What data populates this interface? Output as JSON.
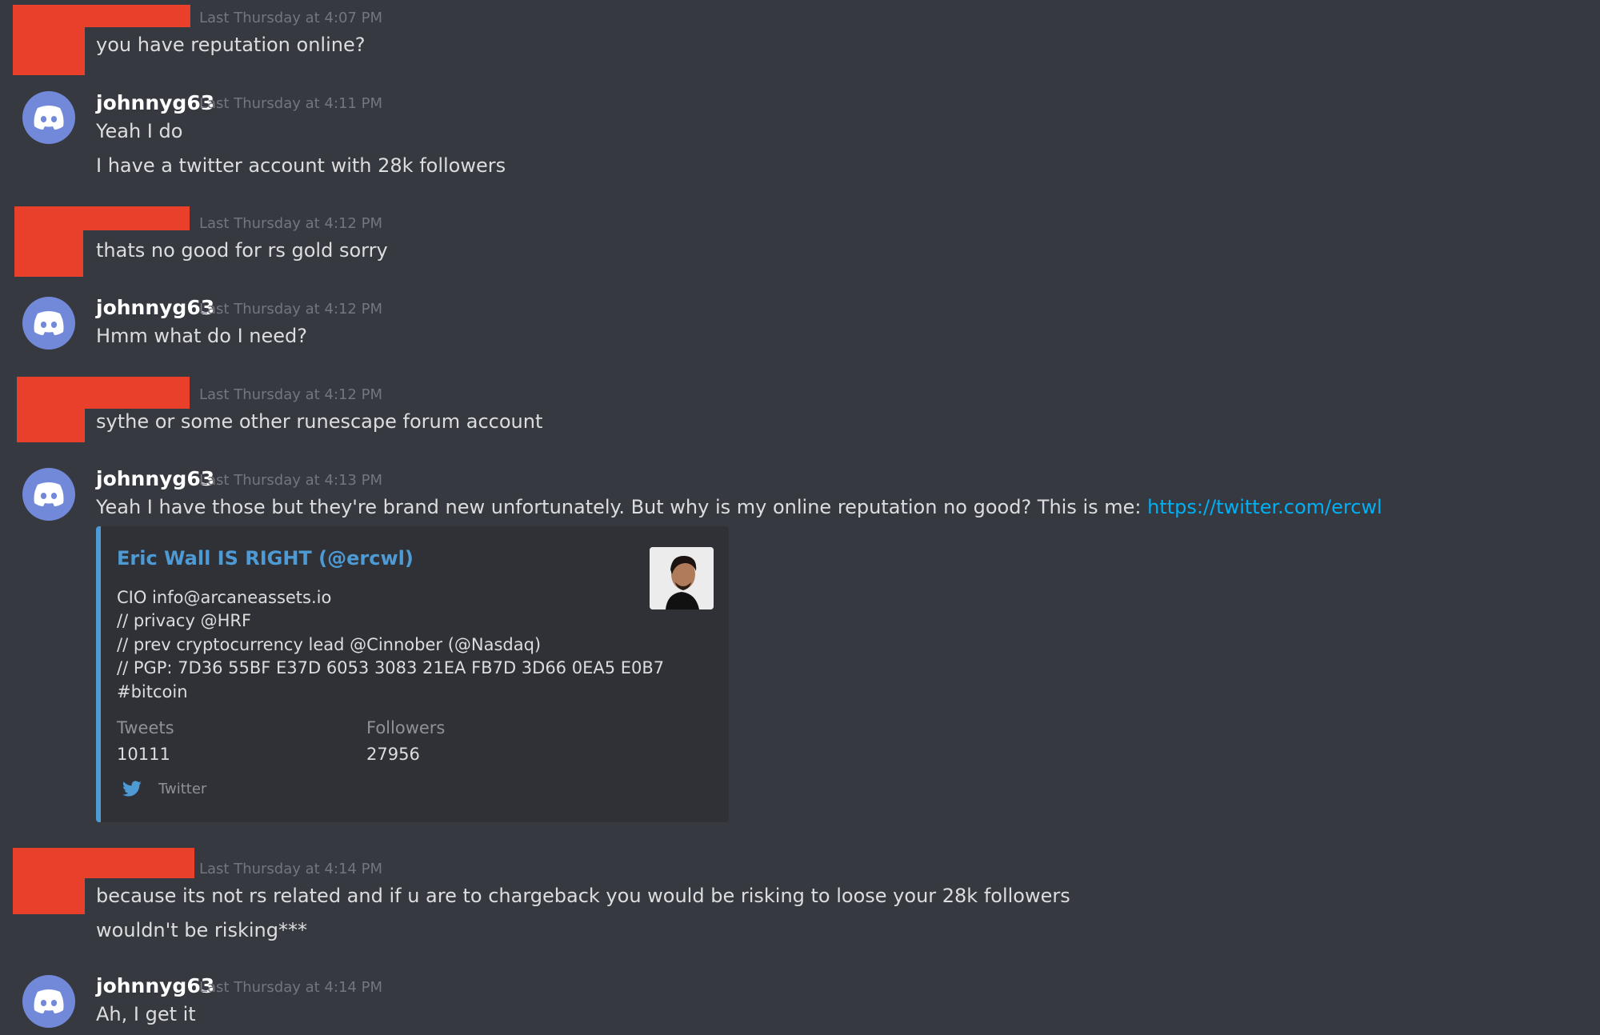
{
  "colors": {
    "background": "#36393f",
    "redaction": "#e8402a",
    "avatar": "#7289da",
    "link": "#00b0f4",
    "embed_accent": "#4e9ad4"
  },
  "messages": [
    {
      "author": "",
      "timestamp": "Last Thursday at 4:07 PM",
      "lines": [
        "you have reputation online?"
      ]
    },
    {
      "author": "johnnyg63",
      "timestamp": "Last Thursday at 4:11 PM",
      "lines": [
        "Yeah I do",
        "I have a twitter account with 28k followers"
      ]
    },
    {
      "author": "",
      "timestamp": "Last Thursday at 4:12 PM",
      "lines": [
        "thats no good for rs gold sorry"
      ]
    },
    {
      "author": "johnnyg63",
      "timestamp": "Last Thursday at 4:12 PM",
      "lines": [
        "Hmm what do I need?"
      ]
    },
    {
      "author": "",
      "timestamp": "Last Thursday at 4:12 PM",
      "lines": [
        "sythe or some other runescape forum account"
      ]
    },
    {
      "author": "johnnyg63",
      "timestamp": "Last Thursday at 4:13 PM",
      "lines": [
        "Yeah I have those but they're brand new unfortunately. But why is my online reputation no good? This is me: "
      ],
      "link": "https://twitter.com/ercwl"
    },
    {
      "author": "",
      "timestamp": "Last Thursday at 4:14 PM",
      "lines": [
        "because its not rs related and if u are to chargeback you would be risking to loose your 28k followers",
        "wouldn't be risking***"
      ]
    },
    {
      "author": "johnnyg63",
      "timestamp": "Last Thursday at 4:14 PM",
      "lines": [
        "Ah, I get it"
      ]
    }
  ],
  "embed": {
    "title": "Eric Wall IS RIGHT (@ercwl)",
    "description": [
      "CIO info@arcaneassets.io",
      "// privacy @HRF",
      "// prev cryptocurrency lead @Cinnober (@Nasdaq)",
      "// PGP: 7D36 55BF E37D 6053 3083 21EA FB7D 3D66 0EA5 E0B7",
      "#bitcoin"
    ],
    "fields": [
      {
        "name": "Tweets",
        "value": "10111"
      },
      {
        "name": "Followers",
        "value": "27956"
      }
    ],
    "footer": "Twitter",
    "footer_icon": "twitter-bird-icon",
    "thumbnail_icon": "profile-photo"
  }
}
